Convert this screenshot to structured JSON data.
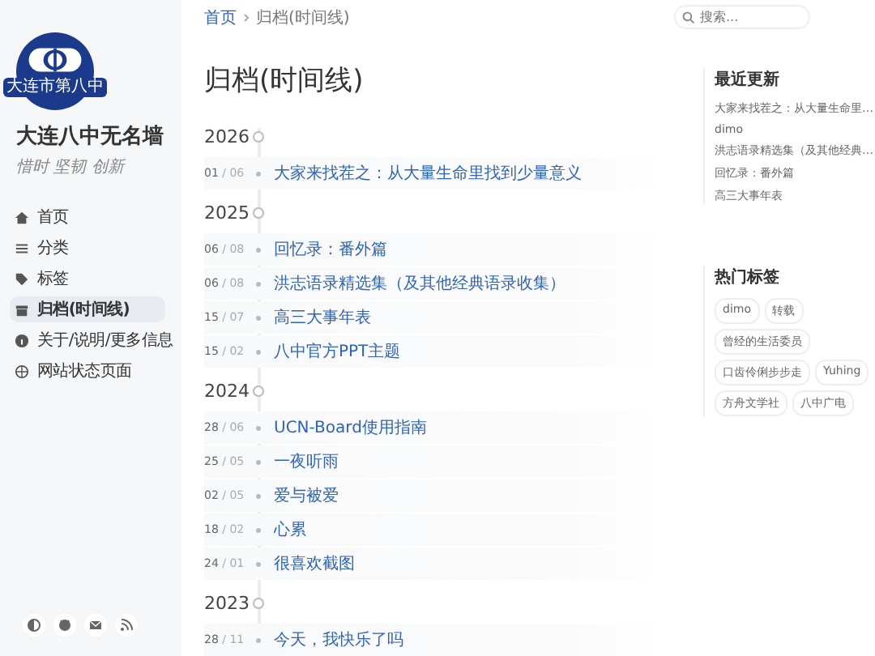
{
  "site": {
    "logo_text": "大连市第八中",
    "title": "大连八中无名墙",
    "subtitle": "惜时 坚韧 创新"
  },
  "nav": [
    {
      "label": "首页",
      "selected": false
    },
    {
      "label": "分类",
      "selected": false
    },
    {
      "label": "标签",
      "selected": false
    },
    {
      "label": "归档(时间线)",
      "selected": true
    },
    {
      "label": "关于/说明/更多信息",
      "selected": false
    },
    {
      "label": "网站状态页面",
      "selected": false
    }
  ],
  "breadcrumb": [
    "首页",
    "归档(时间线)"
  ],
  "page_title": "归档(时间线)",
  "years": [
    {
      "year": "2026",
      "posts": [
        {
          "day": "01",
          "month": "/ 06",
          "title": "大家来找茬之：从大量生命里找到少量意义"
        }
      ]
    },
    {
      "year": "2025",
      "posts": [
        {
          "day": "06",
          "month": "/ 08",
          "title": "回忆录：番外篇"
        },
        {
          "day": "06",
          "month": "/ 08",
          "title": "洪志语录精选集（及其他经典语录收集）"
        },
        {
          "day": "15",
          "month": "/ 07",
          "title": "高三大事年表"
        },
        {
          "day": "15",
          "month": "/ 02",
          "title": "八中官方PPT主题"
        }
      ]
    },
    {
      "year": "2024",
      "posts": [
        {
          "day": "28",
          "month": "/ 06",
          "title": "UCN-Board使用指南"
        },
        {
          "day": "25",
          "month": "/ 05",
          "title": "一夜听雨"
        },
        {
          "day": "02",
          "month": "/ 05",
          "title": "爱与被爱"
        },
        {
          "day": "18",
          "month": "/ 02",
          "title": "心累"
        },
        {
          "day": "24",
          "month": "/ 01",
          "title": "很喜欢截图"
        }
      ]
    },
    {
      "year": "2023",
      "posts": [
        {
          "day": "28",
          "month": "/ 11",
          "title": "今天，我快乐了吗"
        }
      ]
    }
  ],
  "search": {
    "placeholder": "搜索..."
  },
  "recent": {
    "heading": "最近更新",
    "items": [
      "大家来找茬之：从大量生命里…",
      "dimo",
      "洪志语录精选集（及其他经典…",
      "回忆录：番外篇",
      "高三大事年表"
    ]
  },
  "tags": {
    "heading": "热门标签",
    "items": [
      "dimo",
      "转载",
      "曾经的生活委员",
      "口齿伶俐步步走",
      "Yuhing",
      "方舟文学社",
      "八中广电"
    ]
  }
}
